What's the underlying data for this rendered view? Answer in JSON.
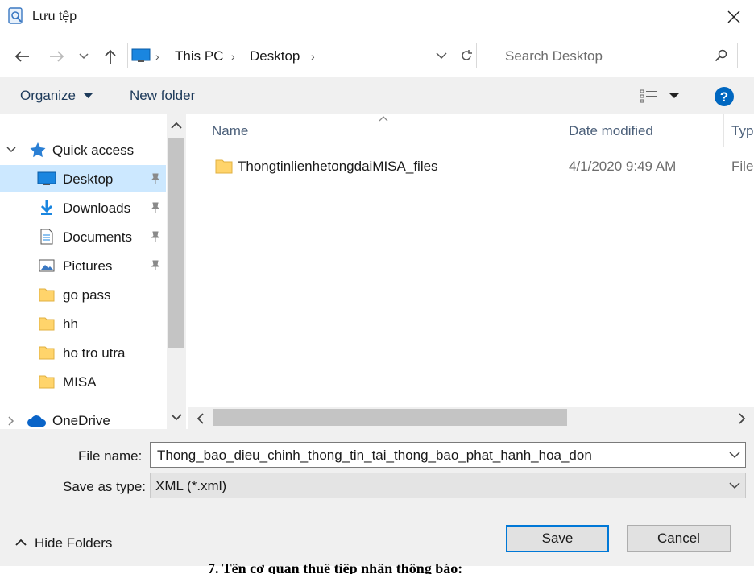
{
  "window": {
    "title": "Lưu tệp"
  },
  "nav": {
    "breadcrumb": [
      "This PC",
      "Desktop"
    ],
    "search_placeholder": "Search Desktop"
  },
  "toolbar": {
    "organize": "Organize",
    "new_folder": "New folder"
  },
  "sidebar": {
    "quick_access": "Quick access",
    "items": [
      {
        "label": "Desktop",
        "icon": "desktop-icon",
        "pinned": true,
        "selected": true
      },
      {
        "label": "Downloads",
        "icon": "download-arrow-icon",
        "pinned": true
      },
      {
        "label": "Documents",
        "icon": "document-icon",
        "pinned": true
      },
      {
        "label": "Pictures",
        "icon": "picture-icon",
        "pinned": true
      },
      {
        "label": "go pass",
        "icon": "folder-icon"
      },
      {
        "label": "hh",
        "icon": "folder-icon"
      },
      {
        "label": "ho tro utra",
        "icon": "folder-icon"
      },
      {
        "label": "MISA",
        "icon": "folder-icon"
      }
    ],
    "onedrive": "OneDrive"
  },
  "file_list": {
    "columns": [
      "Name",
      "Date modified",
      "Typ"
    ],
    "rows": [
      {
        "name": "ThongtinlienhetongdaiMISA_files",
        "date": "4/1/2020 9:49 AM",
        "type": "File"
      }
    ]
  },
  "footer": {
    "file_name_label": "File name:",
    "file_name_value": "Thong_bao_dieu_chinh_thong_tin_tai_thong_bao_phat_hanh_hoa_don",
    "save_type_label": "Save as type:",
    "save_type_value": "XML (*.xml)",
    "hide_folders": "Hide Folders",
    "save": "Save",
    "cancel": "Cancel"
  },
  "background_text": "7. Tên cơ quan thuế tiếp nhận thông báo:",
  "colors": {
    "accent": "#0078d7",
    "selected": "#cce8ff",
    "folder": "#ffd46b"
  }
}
